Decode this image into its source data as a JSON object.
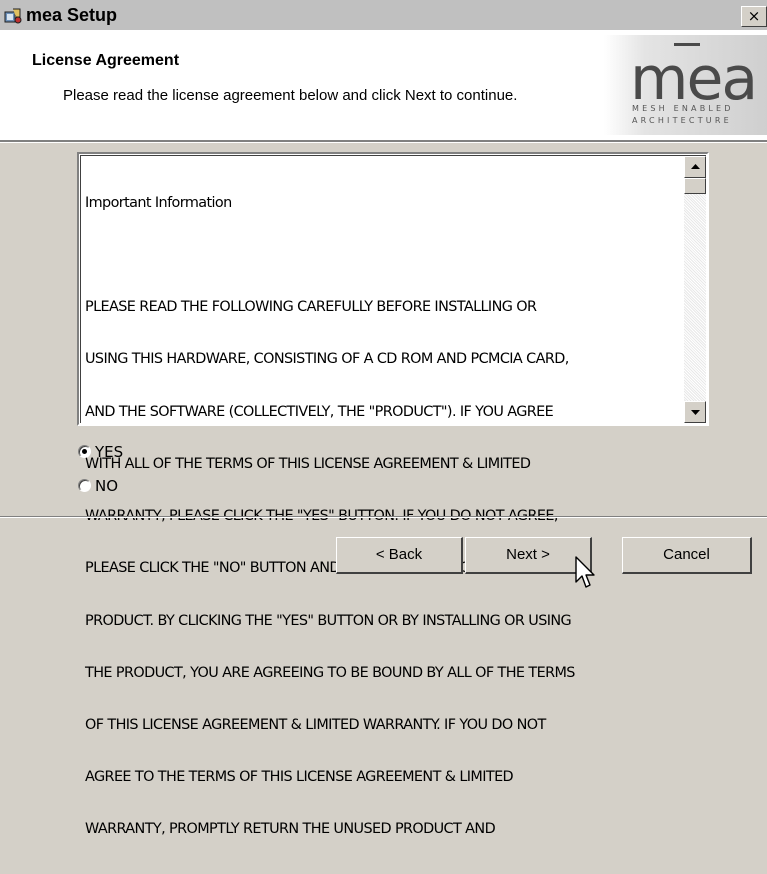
{
  "window": {
    "title": "mea Setup",
    "title_icon": "installer-icon",
    "close_label": "×"
  },
  "header": {
    "title": "License Agreement",
    "subtitle": "Please read the license agreement below and click Next to continue.",
    "logo": {
      "mark": "mea",
      "line1": "MESH ENABLED",
      "line2": "ARCHITECTURE"
    }
  },
  "license": {
    "heading": "Important Information",
    "lines": [
      "PLEASE READ THE FOLLOWING CAREFULLY BEFORE INSTALLING OR",
      "USING THIS HARDWARE, CONSISTING OF A CD ROM AND PCMCIA CARD,",
      "AND THE SOFTWARE (COLLECTIVELY, THE \"PRODUCT\"). IF YOU AGREE",
      "WITH ALL OF THE TERMS OF THIS LICENSE AGREEMENT & LIMITED",
      "WARRANTY, PLEASE CLICK THE \"YES\" BUTTON. IF YOU DO NOT AGREE,",
      "PLEASE CLICK THE \"NO\" BUTTON AND DO NOT INSTALL OR USE THE",
      "PRODUCT. BY CLICKING THE \"YES\" BUTTON OR BY INSTALLING OR USING",
      "THE PRODUCT, YOU ARE AGREEING TO BE BOUND BY ALL OF THE TERMS",
      "OF THIS LICENSE AGREEMENT & LIMITED WARRANTY. IF YOU DO NOT",
      "AGREE TO THE TERMS OF THIS LICENSE AGREEMENT & LIMITED",
      "WARRANTY, PROMPTLY RETURN THE UNUSED PRODUCT AND"
    ]
  },
  "options": {
    "yes_label": "YES",
    "no_label": "NO",
    "selected": "YES"
  },
  "buttons": {
    "back_label": "< Back",
    "next_label": "Next >",
    "cancel_label": "Cancel"
  },
  "colors": {
    "dialog_bg": "#d4d0c8",
    "header_bg": "#ffffff",
    "text": "#000000"
  }
}
